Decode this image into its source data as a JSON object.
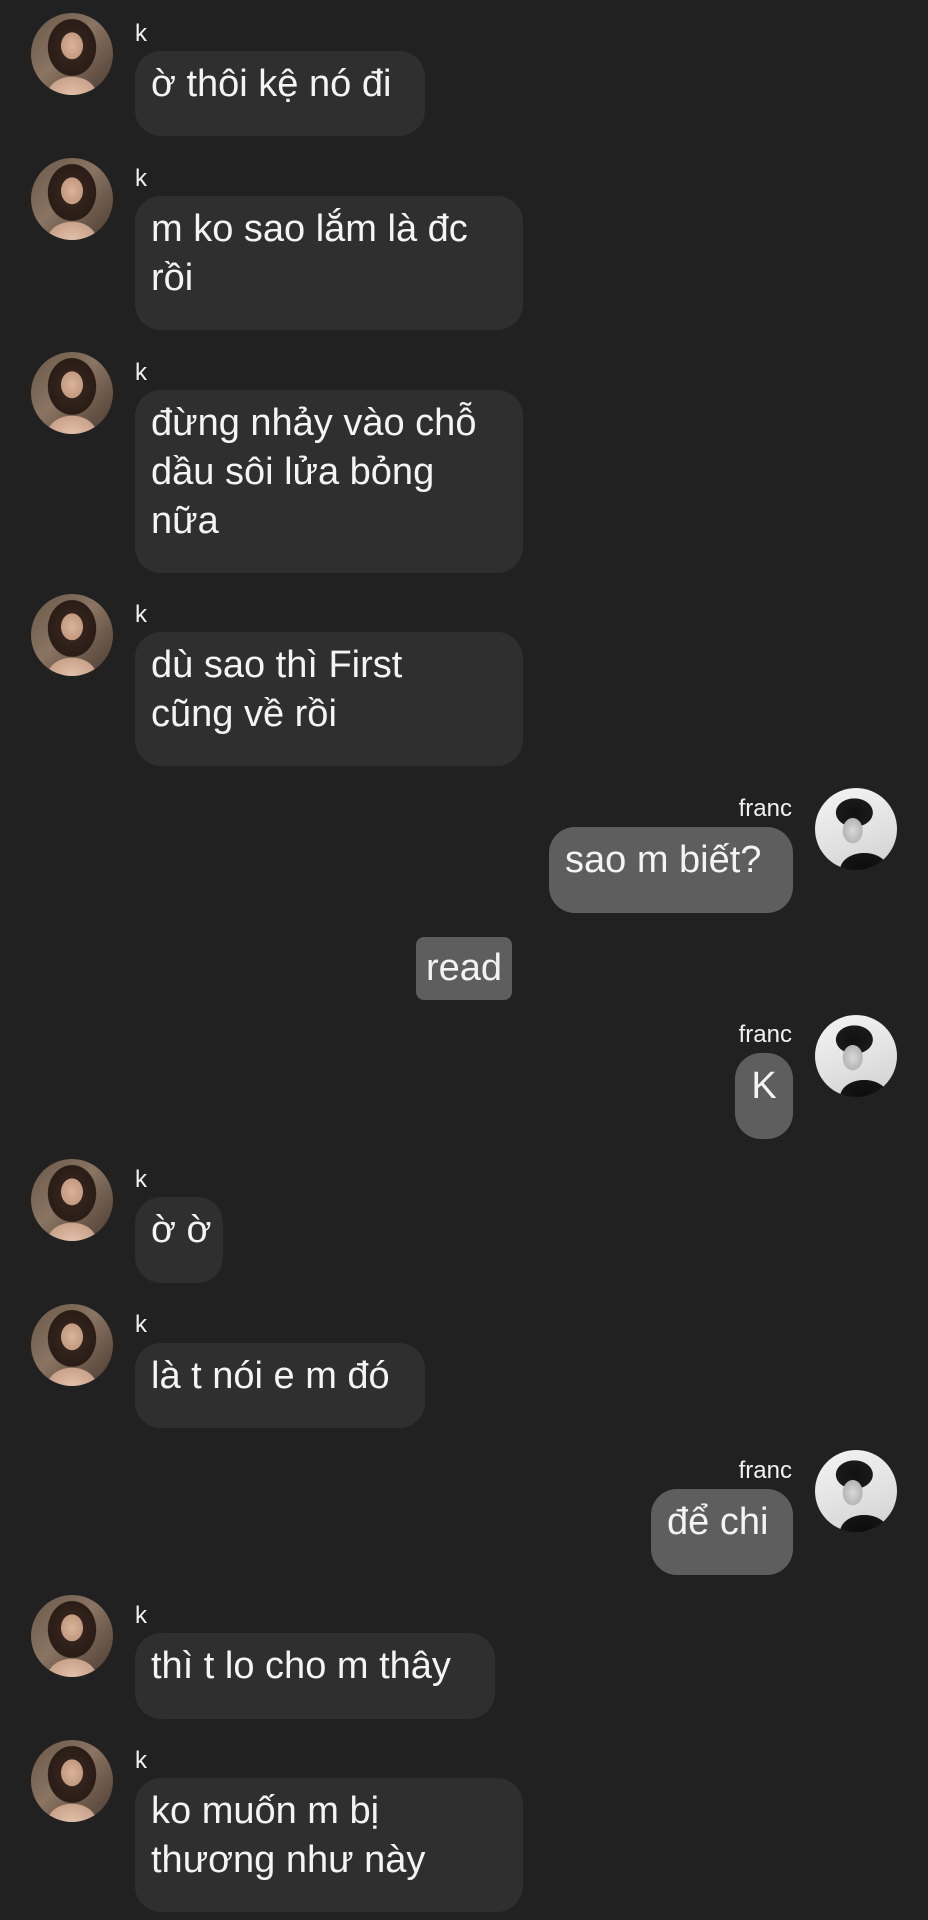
{
  "conversation": {
    "messages": [
      {
        "sender": "k",
        "text": "ờ thôi kệ nó đi",
        "lines": [
          "ờ thôi kệ nó đi"
        ]
      },
      {
        "sender": "k",
        "text": "m ko sao lắm là đc rồi",
        "lines": [
          "m ko sao lắm là đc",
          "rồi"
        ]
      },
      {
        "sender": "k",
        "text": "đừng nhảy vào chỗ dầu sôi lửa bỏng nữa",
        "lines": [
          "đừng nhảy vào chỗ",
          "dầu sôi lửa bỏng",
          "nữa"
        ]
      },
      {
        "sender": "k",
        "text": "dù sao thì First cũng về rồi",
        "lines": [
          "dù sao thì First",
          "cũng về rồi"
        ]
      },
      {
        "sender": "franc",
        "text": "sao m biết?",
        "lines": [
          "sao m biết?"
        ]
      },
      {
        "sender": "franc",
        "text": "K",
        "lines": [
          "K"
        ]
      },
      {
        "sender": "k",
        "text": "ờ ờ",
        "lines": [
          "ờ ờ"
        ]
      },
      {
        "sender": "k",
        "text": "là t nói e m đó",
        "lines": [
          "là t nói e m đó"
        ]
      },
      {
        "sender": "franc",
        "text": "để chi",
        "lines": [
          "để chi"
        ]
      },
      {
        "sender": "k",
        "text": "thì t lo cho m thây",
        "lines": [
          "thì t lo cho m thây"
        ]
      },
      {
        "sender": "k",
        "text": "ko muốn m bị thương như này",
        "lines": [
          "ko muốn m bị",
          "thương như này"
        ]
      }
    ],
    "read_label": "read"
  },
  "colors": {
    "background": "#212121",
    "incoming_bubble": "#2f2f2f",
    "outgoing_bubble": "#5e5e5e",
    "text": "#f4f4f4"
  }
}
